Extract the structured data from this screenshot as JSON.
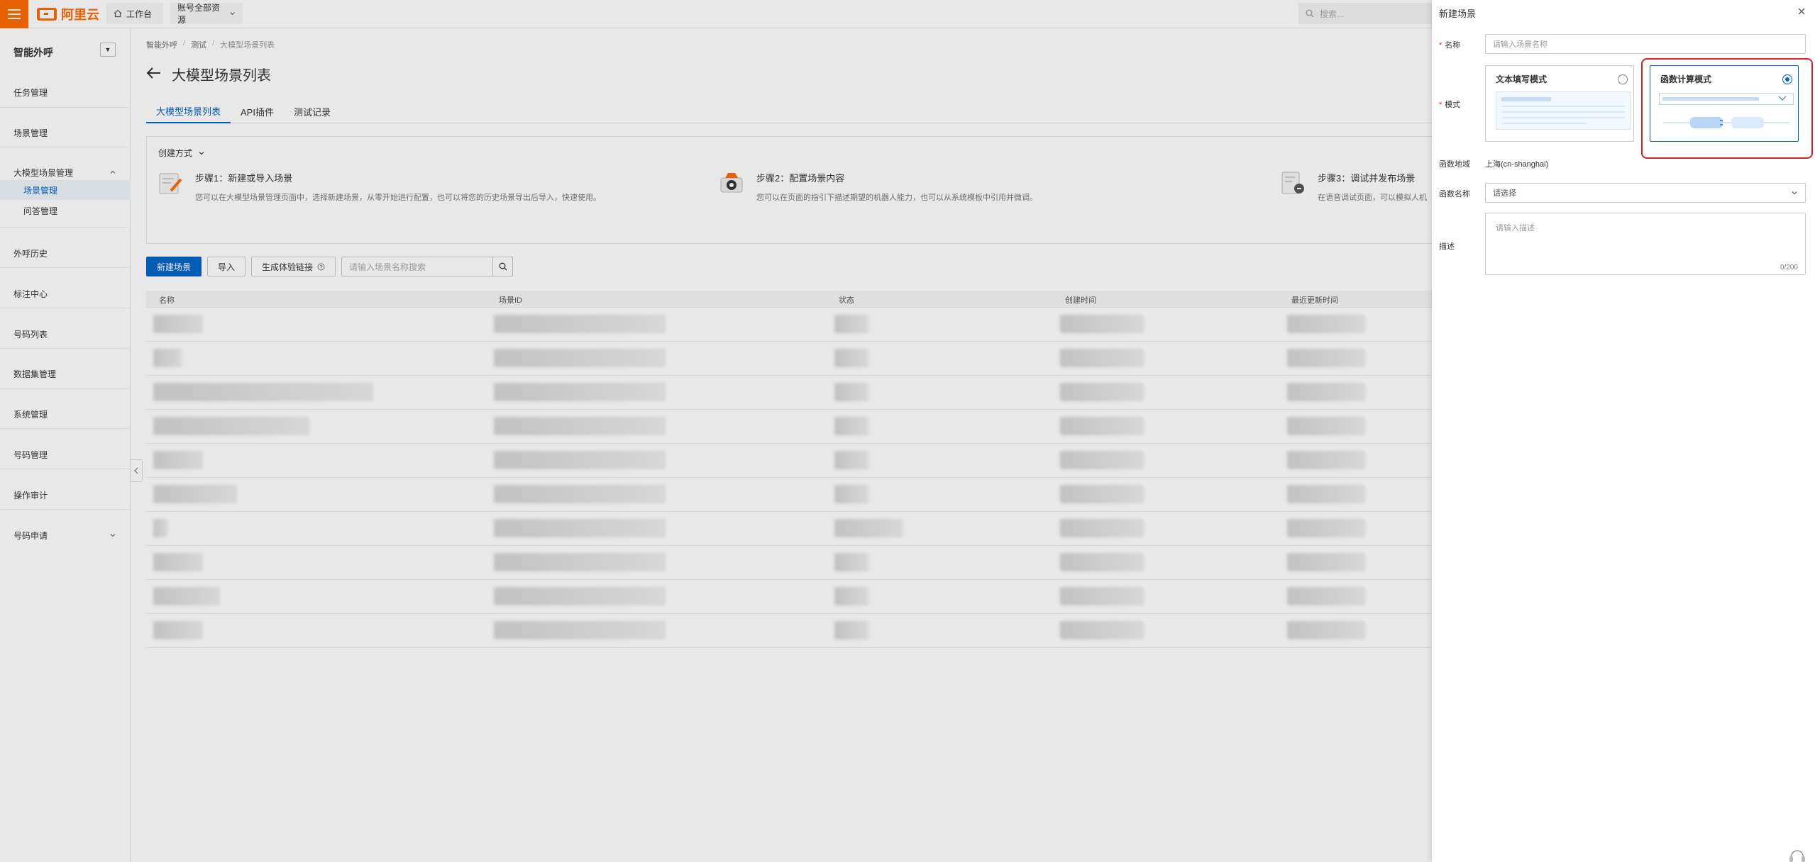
{
  "topbar": {
    "logo_text": "阿里云",
    "workbench_label": "工作台",
    "resource_label": "账号全部资源",
    "search_placeholder": "搜索..."
  },
  "sidebar": {
    "title": "智能外呼",
    "items": [
      {
        "label": "任务管理"
      },
      {
        "label": "场景管理"
      },
      {
        "label": "大模型场景管理"
      },
      {
        "label": "场景管理"
      },
      {
        "label": "问答管理"
      },
      {
        "label": "外呼历史"
      },
      {
        "label": "标注中心"
      },
      {
        "label": "号码列表"
      },
      {
        "label": "数据集管理"
      },
      {
        "label": "系统管理"
      },
      {
        "label": "号码管理"
      },
      {
        "label": "操作审计"
      },
      {
        "label": "号码申请"
      }
    ]
  },
  "main": {
    "breadcrumb": [
      "智能外呼",
      "测试",
      "大模型场景列表"
    ],
    "title": "大模型场景列表",
    "tabs": [
      {
        "label": "大模型场景列表",
        "active": true
      },
      {
        "label": "API插件",
        "active": false
      },
      {
        "label": "测试记录",
        "active": false
      }
    ],
    "create_method_label": "创建方式",
    "steps": [
      {
        "title": "步骤1：新建或导入场景",
        "desc": "您可以在大模型场景管理页面中，选择新建场景，从零开始进行配置，也可以将您的历史场景导出后导入，快速使用。"
      },
      {
        "title": "步骤2：配置场景内容",
        "desc": "您可以在页面的指引下描述期望的机器人能力，也可以从系统模板中引用并微调。"
      },
      {
        "title": "步骤3：调试并发布场景",
        "desc": "在语音调试页面，可以模拟人机"
      }
    ],
    "toolbar": {
      "new_button": "新建场景",
      "import_button": "导入",
      "link_button": "生成体验链接",
      "search_placeholder": "请输入场景名称搜索"
    },
    "table": {
      "columns": [
        "名称",
        "场景ID",
        "状态",
        "创建时间",
        "最近更新时间"
      ]
    }
  },
  "drawer": {
    "title": "新建场景",
    "name_label": "名称",
    "name_placeholder": "请输入场景名称",
    "mode_label": "模式",
    "modes": [
      {
        "label": "文本填写模式",
        "selected": false
      },
      {
        "label": "函数计算模式",
        "selected": true
      }
    ],
    "region_label": "函数地域",
    "region_value": "上海(cn-shanghai)",
    "function_label": "函数名称",
    "function_placeholder": "请选择",
    "desc_label": "描述",
    "desc_placeholder": "请输入描述",
    "desc_count": "0/200"
  },
  "colors": {
    "brand_orange": "#ff6a00",
    "primary_blue": "#0064c8",
    "highlight_red": "#d92020"
  }
}
